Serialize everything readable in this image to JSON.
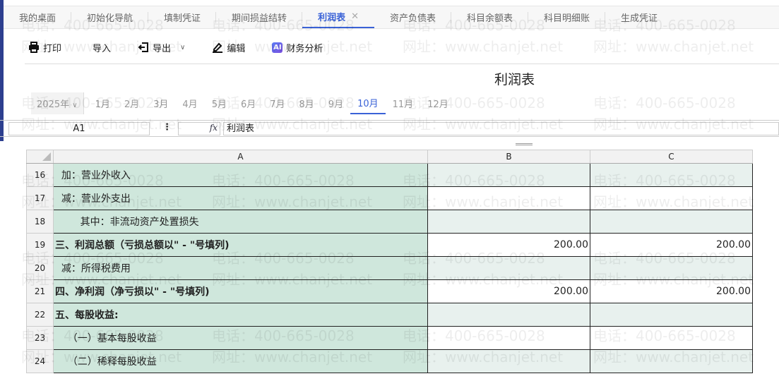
{
  "tabs": [
    {
      "label": "我的桌面"
    },
    {
      "label": "初始化导航"
    },
    {
      "label": "填制凭证"
    },
    {
      "label": "期间损益结转"
    },
    {
      "label": "利润表",
      "active": true,
      "close": "✕"
    },
    {
      "label": "资产负债表"
    },
    {
      "label": "科目余额表"
    },
    {
      "label": "科目明细账"
    },
    {
      "label": "生成凭证"
    }
  ],
  "toolbar": {
    "print": "打印",
    "import": "导入",
    "export": "导出",
    "edit": "编辑",
    "ai_badge": "AI",
    "analysis": "财务分析"
  },
  "report_title": "利润表",
  "period": {
    "year": "2025年",
    "months": [
      "1月",
      "2月",
      "3月",
      "4月",
      "5月",
      "6月",
      "7月",
      "8月",
      "9月",
      "10月",
      "11月",
      "12月"
    ],
    "selected": "10月"
  },
  "formula_bar": {
    "cell_ref": "A1",
    "fx": "fx",
    "value": "利润表"
  },
  "grid": {
    "columns": [
      "A",
      "B",
      "C"
    ],
    "rows": [
      {
        "n": "16",
        "a": "  加：营业外收入",
        "b": "",
        "c": "",
        "bold": false
      },
      {
        "n": "17",
        "a": "  减：营业外支出",
        "b": "",
        "c": "",
        "bold": false
      },
      {
        "n": "18",
        "a": "        其中：非流动资产处置损失",
        "b": "",
        "c": "",
        "bold": false
      },
      {
        "n": "19",
        "a": "三、利润总额（亏损总额以\" - \"号填列)",
        "b": "200.00",
        "c": "200.00",
        "bold": true
      },
      {
        "n": "20",
        "a": "  减：所得税费用",
        "b": "",
        "c": "",
        "bold": false
      },
      {
        "n": "21",
        "a": "四、净利润（净亏损以\" - \"号填列)",
        "b": "200.00",
        "c": "200.00",
        "bold": true
      },
      {
        "n": "22",
        "a": "五、每股收益:",
        "b": "",
        "c": "",
        "bold": true
      },
      {
        "n": "23",
        "a": "    （一）基本每股收益",
        "b": "",
        "c": "",
        "bold": false
      },
      {
        "n": "24",
        "a": "    （二）稀释每股收益",
        "b": "",
        "c": "",
        "bold": false
      }
    ]
  },
  "watermark": {
    "phone": "电话：400-665-0028",
    "site": "网址：www.chanjet.net"
  },
  "colors": {
    "accent": "#3a62d7",
    "cell_green": "#cfe7dc"
  }
}
